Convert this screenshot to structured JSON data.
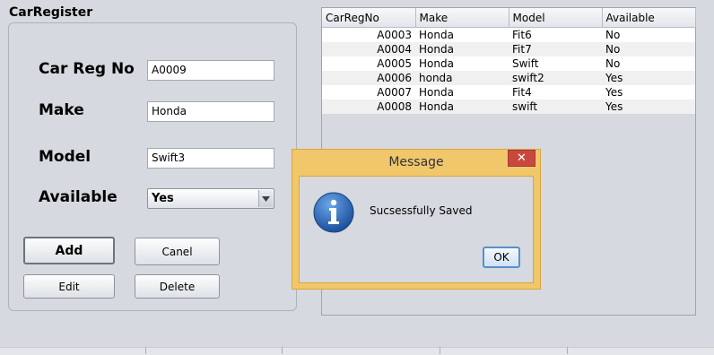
{
  "window": {
    "title": "CarRegister"
  },
  "form": {
    "reg_label": "Car Reg No",
    "reg_value": "A0009",
    "make_label": "Make",
    "make_value": "Honda",
    "model_label": "Model",
    "model_value": "Swift3",
    "available_label": "Available",
    "available_value": "Yes"
  },
  "buttons": {
    "add": "Add",
    "cancel": "Canel",
    "edit": "Edit",
    "delete": "Delete"
  },
  "table": {
    "headers": [
      "CarRegNo",
      "Make",
      "Model",
      "Available"
    ],
    "rows": [
      [
        "A0003",
        "Honda",
        "Fit6",
        "No"
      ],
      [
        "A0004",
        "Honda",
        "Fit7",
        "No"
      ],
      [
        "A0005",
        "Honda",
        "Swift",
        "No"
      ],
      [
        "A0006",
        "honda",
        "swift2",
        "Yes"
      ],
      [
        "A0007",
        "Honda",
        "Fit4",
        "Yes"
      ],
      [
        "A0008",
        "Honda",
        "swift",
        "Yes"
      ]
    ]
  },
  "dialog": {
    "title": "Message",
    "message": "Sucsessfully Saved",
    "ok_label": "OK",
    "close_glyph": "✕",
    "icon": "info-icon",
    "accent_color": "#f1c76b",
    "close_color": "#c9483d"
  }
}
